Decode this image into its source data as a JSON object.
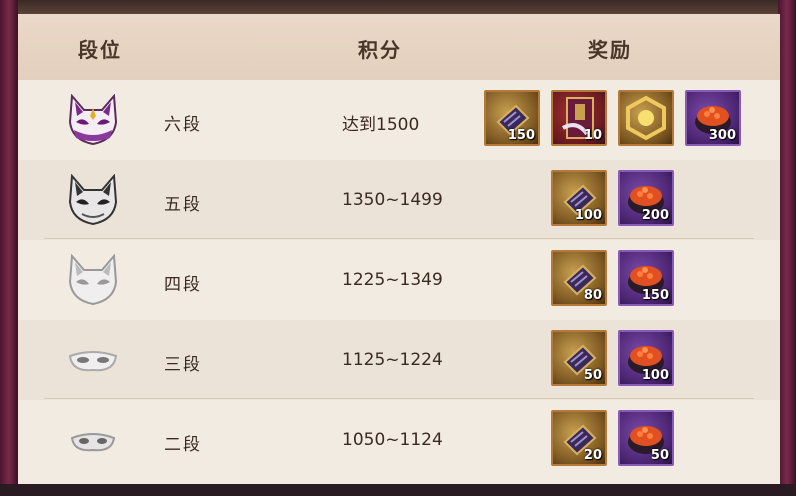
{
  "header": {
    "rank": "段位",
    "score": "积分",
    "reward": "奖励"
  },
  "rows": [
    {
      "rank": "六段",
      "score": "达到1500",
      "mask": "purple-fox-mask-icon",
      "rewards": [
        {
          "icon": "gold-ticket-icon",
          "count": "150"
        },
        {
          "icon": "red-scroll-icon",
          "count": "10"
        },
        {
          "icon": "gold-frame-icon",
          "count": ""
        },
        {
          "icon": "sushi-icon",
          "count": "300"
        }
      ]
    },
    {
      "rank": "五段",
      "score": "1350~1499",
      "mask": "gray-fox-mask-icon",
      "rewards": [
        {
          "icon": "gold-ticket-icon",
          "count": "100"
        },
        {
          "icon": "sushi-icon",
          "count": "200"
        }
      ]
    },
    {
      "rank": "四段",
      "score": "1225~1349",
      "mask": "white-fox-mask-icon",
      "rewards": [
        {
          "icon": "gold-ticket-icon",
          "count": "80"
        },
        {
          "icon": "sushi-icon",
          "count": "150"
        }
      ]
    },
    {
      "rank": "三段",
      "score": "1125~1224",
      "mask": "eye-mask-icon",
      "rewards": [
        {
          "icon": "gold-ticket-icon",
          "count": "50"
        },
        {
          "icon": "sushi-icon",
          "count": "100"
        }
      ]
    },
    {
      "rank": "二段",
      "score": "1050~1124",
      "mask": "small-eye-mask-icon",
      "rewards": [
        {
          "icon": "gold-ticket-icon",
          "count": "20"
        },
        {
          "icon": "sushi-icon",
          "count": "50"
        }
      ]
    }
  ]
}
